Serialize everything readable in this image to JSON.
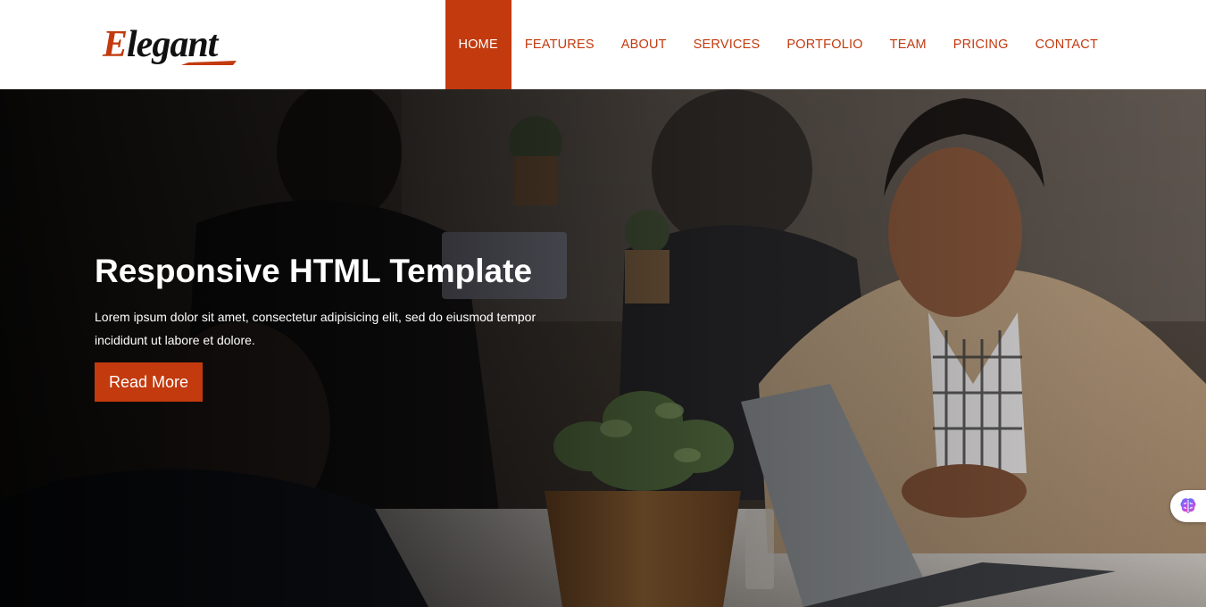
{
  "logo": {
    "first_letter": "E",
    "rest": "legant"
  },
  "nav": {
    "items": [
      {
        "label": "HOME",
        "active": true
      },
      {
        "label": "FEATURES"
      },
      {
        "label": "ABOUT"
      },
      {
        "label": "SERVICES"
      },
      {
        "label": "PORTFOLIO"
      },
      {
        "label": "TEAM"
      },
      {
        "label": "PRICING"
      },
      {
        "label": "CONTACT"
      }
    ]
  },
  "hero": {
    "title": "Responsive HTML Template",
    "text": "Lorem ipsum dolor sit amet, consectetur adipisicing elit, sed do eiusmod tempor incididunt ut labore et dolore.",
    "button_label": "Read More",
    "background": "business-meeting-photo"
  },
  "floating_widget": {
    "icon": "brain-icon"
  },
  "colors": {
    "accent": "#c23a0e",
    "header_bg": "#ffffff",
    "text_light": "#ffffff"
  }
}
